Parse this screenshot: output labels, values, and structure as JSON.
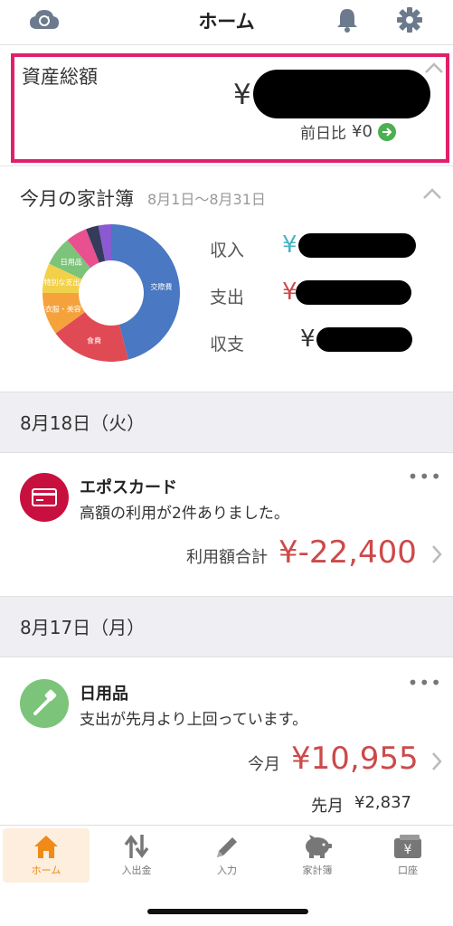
{
  "header": {
    "title": "ホーム"
  },
  "assets": {
    "label": "資産総額",
    "currency": "¥",
    "diff_label": "前日比",
    "diff_value": "¥0"
  },
  "budget": {
    "title": "今月の家計簿",
    "range": "8月1日〜8月31日",
    "rows": [
      {
        "label": "収入",
        "yen": "¥",
        "color": "#46b3c4"
      },
      {
        "label": "支出",
        "yen": "¥-",
        "color": "#cc4a4a"
      },
      {
        "label": "収支",
        "yen": "¥",
        "color": "#333333"
      }
    ],
    "chart_data": {
      "type": "pie",
      "categories": [
        "交際費",
        "食費",
        "衣服・美容",
        "特別な支出",
        "日用品",
        "",
        "",
        ""
      ],
      "values": [
        46,
        19,
        10,
        7,
        7,
        5,
        3,
        3
      ],
      "colors": [
        "#4a78c2",
        "#e04a55",
        "#f5a23c",
        "#f2d14a",
        "#7cc47a",
        "#e9508f",
        "#353b5a",
        "#8a5ad2"
      ],
      "visible_labels": [
        "交際費",
        "食費",
        "衣服・美容",
        "特別な支出",
        "日用品"
      ]
    }
  },
  "feed": [
    {
      "date": "8月18日（火）",
      "name": "エポスカード",
      "message": "高額の利用が2件ありました。",
      "caption": "利用額合計",
      "amount": "¥-22,400"
    },
    {
      "date": "8月17日（月）",
      "name": "日用品",
      "message": "支出が先月より上回っています。",
      "caption": "今月",
      "amount": "¥10,955",
      "prev_label": "先月",
      "prev_value": "¥2,837"
    }
  ],
  "tabs": [
    {
      "label": "ホーム",
      "icon": "home-icon"
    },
    {
      "label": "入出金",
      "icon": "transfer-arrows-icon"
    },
    {
      "label": "入力",
      "icon": "pencil-icon"
    },
    {
      "label": "家計簿",
      "icon": "piggy-bank-icon"
    },
    {
      "label": "口座",
      "icon": "wallet-icon"
    }
  ]
}
